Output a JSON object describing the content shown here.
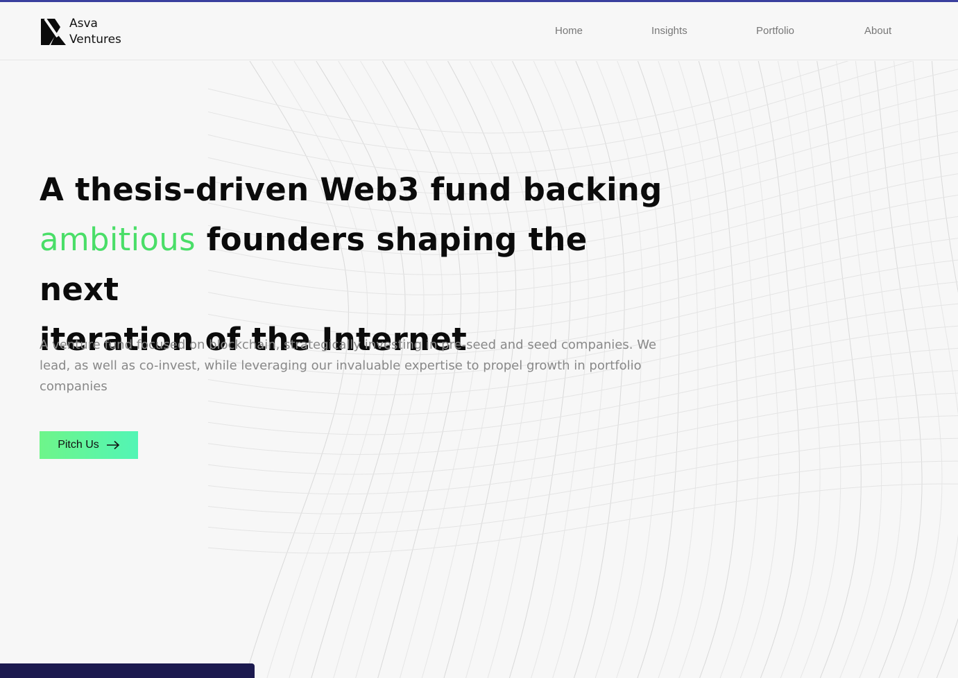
{
  "header": {
    "brand_line1": "Asva",
    "brand_line2": "Ventures",
    "logo_icon": "asva-logo-icon",
    "nav": [
      {
        "label": "Home"
      },
      {
        "label": "Insights"
      },
      {
        "label": "Portfolio"
      },
      {
        "label": "About"
      }
    ]
  },
  "hero": {
    "title_part1": "A thesis-driven Web3 fund backing",
    "title_accent": "ambitious",
    "title_part2": " founders shaping the next",
    "title_part3": "iteration of the Internet",
    "description": "A venture fund focused on blockchain, strategically investing in pre-seed and seed companies. We lead, as well as co-invest, while leveraging our invaluable expertise to propel growth in portfolio companies",
    "cta_label": "Pitch Us",
    "cta_icon": "arrow-right-icon"
  },
  "colors": {
    "accent": "#4ade68",
    "top_line": "#3a3f9e",
    "bottom_bar": "#1c1a4f",
    "button_gradient": [
      "#6ef58a",
      "#52f5b5"
    ]
  }
}
